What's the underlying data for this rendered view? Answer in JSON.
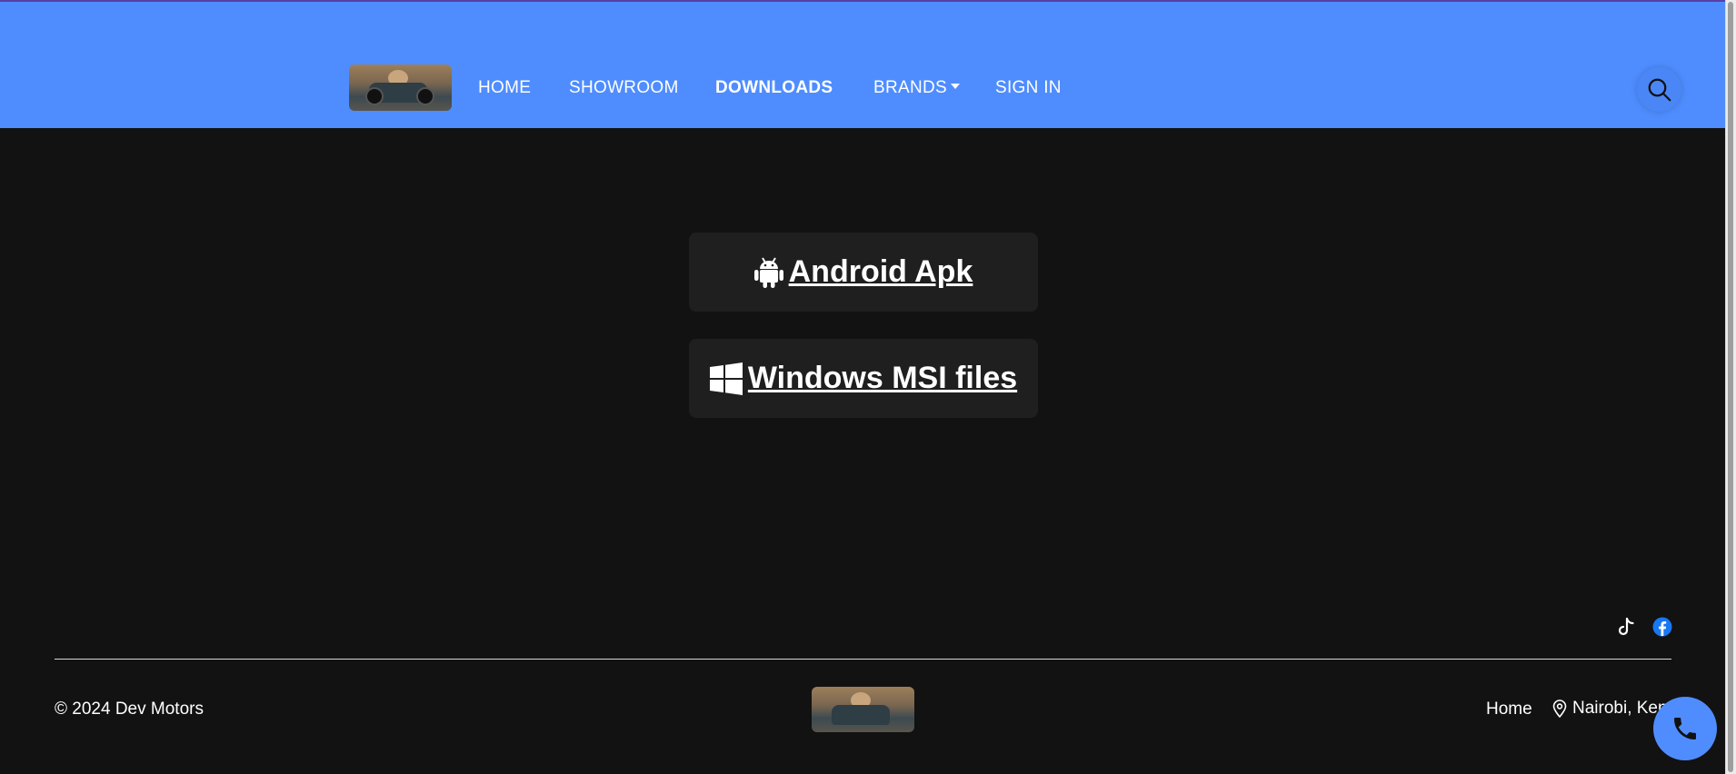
{
  "nav": {
    "links": [
      {
        "label": "HOME"
      },
      {
        "label": "SHOWROOM"
      },
      {
        "label": "DOWNLOADS"
      },
      {
        "label": "BRANDS"
      },
      {
        "label": "SIGN IN"
      }
    ]
  },
  "downloads": {
    "android_label": " Android Apk",
    "windows_label": " Windows MSI files"
  },
  "footer": {
    "copyright": "© 2024 Dev Motors",
    "home_link": "Home",
    "location": "Nairobi, Kenya"
  },
  "icons": {
    "search": "search-icon",
    "android": "android-icon",
    "windows": "windows-icon",
    "tiktok": "tiktok-icon",
    "facebook": "facebook-icon",
    "location": "map-pin-icon",
    "phone": "phone-icon"
  },
  "colors": {
    "header_bg": "#4f8dff",
    "page_bg": "#121212",
    "card_bg": "#1f1f1f",
    "facebook": "#1877f2"
  }
}
